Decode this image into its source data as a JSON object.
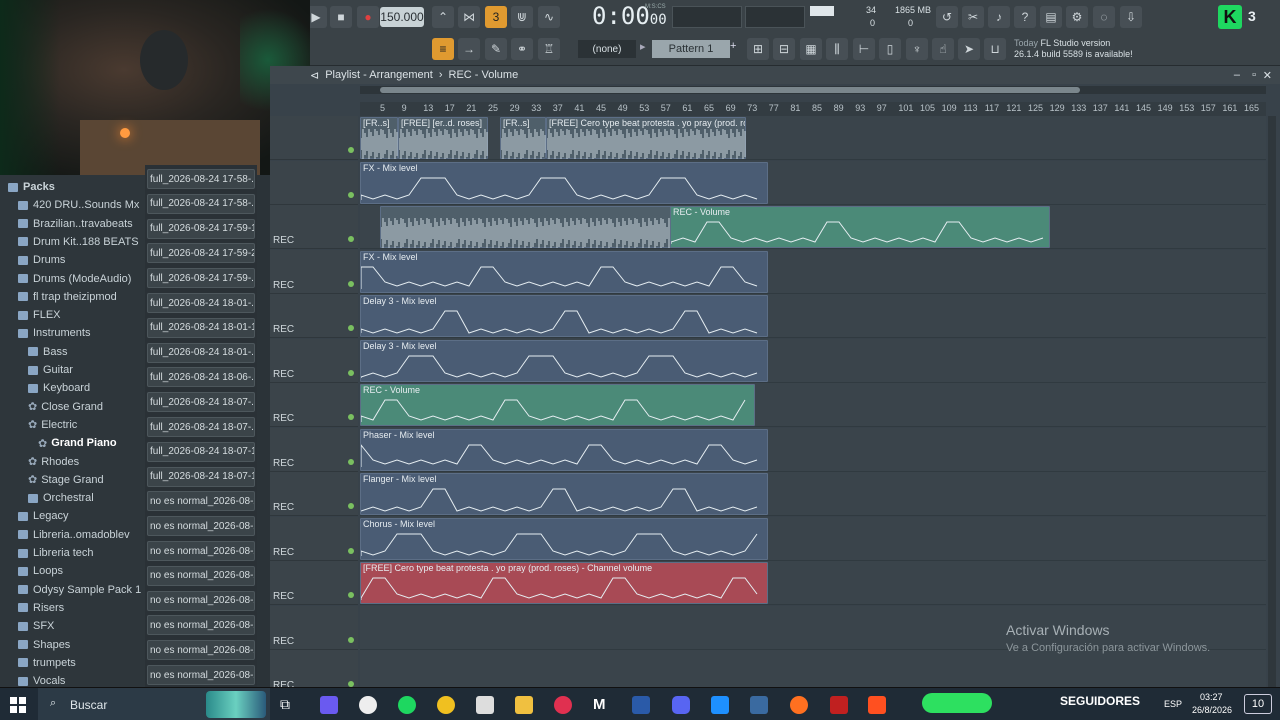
{
  "toolbar": {
    "tempo": "150.000",
    "time": "0:00",
    "time_ms": "00",
    "time_unit": "M:S:CS",
    "cpu": "34",
    "mem": "1865 MB",
    "mem_sub": "0",
    "voices": "0",
    "pattern_none": "(none)",
    "pattern": "Pattern 1",
    "news_line1_prefix": "Today",
    "news_line1": "FL Studio version",
    "news_line2": "26.1.4 build 5589 is available!"
  },
  "playlist": {
    "title": "Playlist - Arrangement",
    "breadcrumb_sep": "›",
    "breadcrumb": "REC - Volume",
    "ruler": [
      "5",
      "9",
      "13",
      "17",
      "21",
      "25",
      "29",
      "33",
      "37",
      "41",
      "45",
      "49",
      "53",
      "57",
      "61",
      "65",
      "69",
      "73",
      "77",
      "81",
      "85",
      "89",
      "93",
      "97",
      "101",
      "105",
      "109",
      "113",
      "117",
      "121",
      "125",
      "129",
      "133",
      "137",
      "141",
      "145",
      "149",
      "153",
      "157",
      "161",
      "165"
    ],
    "tracks": [
      {
        "name": "",
        "clips": [
          {
            "label": "[FR..s]",
            "kind": "audio"
          },
          {
            "label": "[FREE] [er..d. roses]",
            "kind": "audio"
          },
          {
            "label": "[FR..s]",
            "kind": "audio"
          },
          {
            "label": "[FREE] Cero type beat protesta . yo pray (prod. roses)",
            "kind": "audio"
          }
        ]
      },
      {
        "name": "",
        "clips": [
          {
            "label": "FX - Mix level",
            "kind": "auto"
          }
        ]
      },
      {
        "name": "REC",
        "clips": [
          {
            "label": "",
            "kind": "audio"
          },
          {
            "label": "REC - Volume",
            "kind": "auto-green"
          }
        ]
      },
      {
        "name": "REC",
        "clips": [
          {
            "label": "FX - Mix level",
            "kind": "auto"
          }
        ]
      },
      {
        "name": "REC",
        "clips": [
          {
            "label": "Delay 3 - Mix level",
            "kind": "auto"
          }
        ]
      },
      {
        "name": "REC",
        "clips": [
          {
            "label": "Delay 3 - Mix level",
            "kind": "auto"
          }
        ]
      },
      {
        "name": "REC",
        "clips": [
          {
            "label": "REC - Volume",
            "kind": "auto-green"
          }
        ]
      },
      {
        "name": "REC",
        "clips": [
          {
            "label": "Phaser - Mix level",
            "kind": "auto"
          }
        ]
      },
      {
        "name": "REC",
        "clips": [
          {
            "label": "Flanger - Mix level",
            "kind": "auto"
          }
        ]
      },
      {
        "name": "REC",
        "clips": [
          {
            "label": "Chorus - Mix level",
            "kind": "auto"
          }
        ]
      },
      {
        "name": "REC",
        "clips": [
          {
            "label": "[FREE] Cero type beat protesta . yo pray (prod. roses) - Channel volume",
            "kind": "auto-red"
          }
        ]
      },
      {
        "name": "REC",
        "clips": []
      },
      {
        "name": "REC",
        "clips": []
      }
    ]
  },
  "browser": {
    "items": [
      {
        "label": "Packs",
        "kind": "folder",
        "indent": 0
      },
      {
        "label": "420 DRU..Sounds Mx",
        "kind": "folder",
        "indent": 1
      },
      {
        "label": "Brazilian..travabeats",
        "kind": "folder",
        "indent": 1
      },
      {
        "label": "Drum Kit..188 BEATS",
        "kind": "folder",
        "indent": 1
      },
      {
        "label": "Drums",
        "kind": "folder",
        "indent": 1
      },
      {
        "label": "Drums (ModeAudio)",
        "kind": "folder",
        "indent": 1
      },
      {
        "label": "fl trap theizipmod",
        "kind": "folder",
        "indent": 1
      },
      {
        "label": "FLEX",
        "kind": "folder",
        "indent": 1
      },
      {
        "label": "Instruments",
        "kind": "folder",
        "indent": 1
      },
      {
        "label": "Bass",
        "kind": "folder",
        "indent": 2
      },
      {
        "label": "Guitar",
        "kind": "folder",
        "indent": 2
      },
      {
        "label": "Keyboard",
        "kind": "folder",
        "indent": 2
      },
      {
        "label": "Close Grand",
        "kind": "preset",
        "indent": 2
      },
      {
        "label": "Electric",
        "kind": "preset",
        "indent": 2
      },
      {
        "label": "Grand Piano",
        "kind": "preset",
        "indent": 3
      },
      {
        "label": "Rhodes",
        "kind": "preset",
        "indent": 2
      },
      {
        "label": "Stage Grand",
        "kind": "preset",
        "indent": 2
      },
      {
        "label": "Orchestral",
        "kind": "folder",
        "indent": 2
      },
      {
        "label": "Legacy",
        "kind": "folder",
        "indent": 1
      },
      {
        "label": "Libreria..omadoblev",
        "kind": "folder",
        "indent": 1
      },
      {
        "label": "Libreria tech",
        "kind": "folder",
        "indent": 1
      },
      {
        "label": "Loops",
        "kind": "folder",
        "indent": 1
      },
      {
        "label": "Odysy Sample Pack 1",
        "kind": "folder",
        "indent": 1
      },
      {
        "label": "Risers",
        "kind": "folder",
        "indent": 1
      },
      {
        "label": "SFX",
        "kind": "folder",
        "indent": 1
      },
      {
        "label": "Shapes",
        "kind": "folder",
        "indent": 1
      },
      {
        "label": "trumpets",
        "kind": "folder",
        "indent": 1
      },
      {
        "label": "Vocals",
        "kind": "folder",
        "indent": 1
      }
    ]
  },
  "files": {
    "items": [
      "full_2026-08-24 17-58-...",
      "full_2026-08-24 17-58-...",
      "full_2026-08-24 17-59-1...",
      "full_2026-08-24 17-59-2...",
      "full_2026-08-24 17-59-...",
      "full_2026-08-24 18-01-...",
      "full_2026-08-24 18-01-1...",
      "full_2026-08-24 18-01-...",
      "full_2026-08-24 18-06-...",
      "full_2026-08-24 18-07-...",
      "full_2026-08-24 18-07-...",
      "full_2026-08-24 18-07-1...",
      "full_2026-08-24 18-07-1...",
      "no es normal_2026-08-2...",
      "no es normal_2026-08-2...",
      "no es normal_2026-08-2...",
      "no es normal_2026-08-2...",
      "no es normal_2026-08-2...",
      "no es normal_2026-08-2...",
      "no es normal_2026-08-2...",
      "no es normal_2026-08-2..."
    ]
  },
  "watermark": {
    "line1": "Activar Windows",
    "line2": "Ve a Configuración para activar Windows."
  },
  "taskbar": {
    "search_placeholder": "Buscar",
    "seguidores": "SEGUIDORES",
    "lang": "ESP",
    "time": "03:27",
    "date": "26/8/2026",
    "notif": "10",
    "top_right_count": "3"
  },
  "colors": {
    "accent": "#f0a020",
    "auto_clip": "#4a5c74",
    "green_clip": "#4b8a78",
    "red_clip": "#a84a55"
  }
}
